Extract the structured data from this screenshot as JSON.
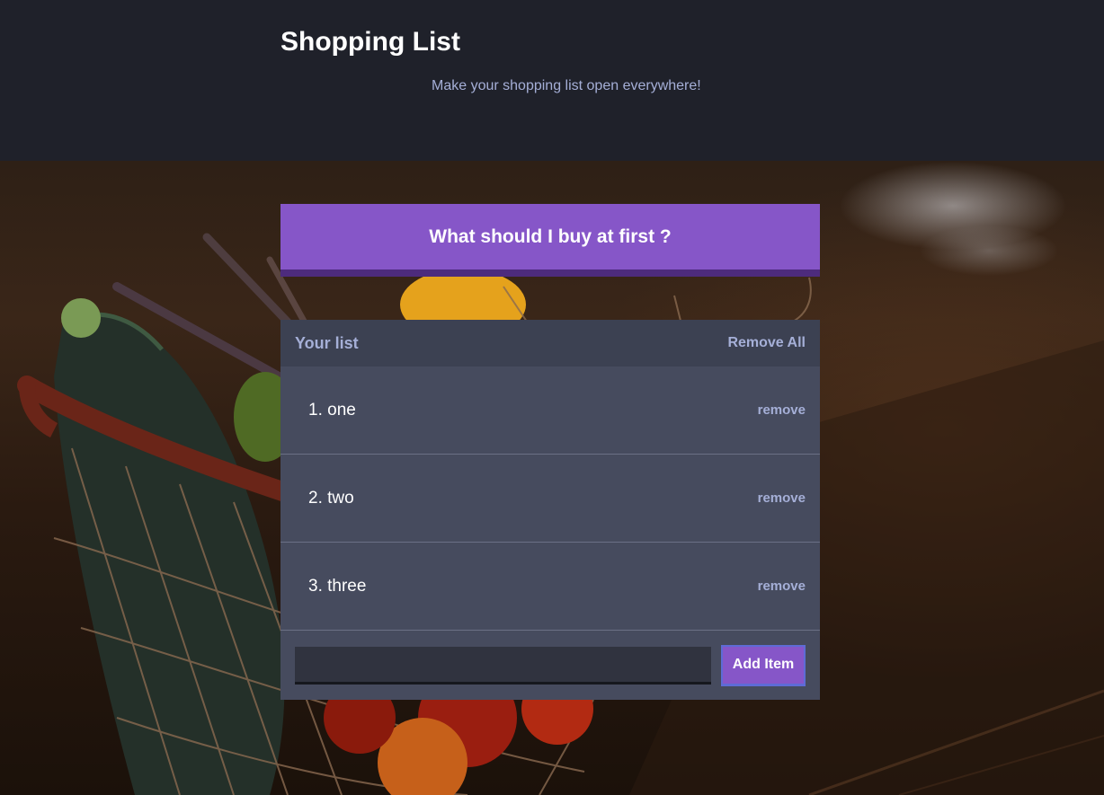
{
  "header": {
    "title": "Shopping List",
    "subtitle": "Make your shopping list open everywhere!"
  },
  "prompt": {
    "text": "What should I buy at first ?"
  },
  "list": {
    "title": "Your list",
    "remove_all_label": "Remove All",
    "items": [
      {
        "text": "1. one",
        "remove_label": "remove"
      },
      {
        "text": "2. two",
        "remove_label": "remove"
      },
      {
        "text": "3. three",
        "remove_label": "remove"
      }
    ]
  },
  "add_form": {
    "input_value": "",
    "button_label": "Add Item"
  },
  "colors": {
    "accent": "#8656c8",
    "accent_dark": "#4d2b7d",
    "header_bg": "#1f212a",
    "panel_bg": "#464b5e",
    "panel_header_bg": "#3c4152",
    "muted_text": "#a5afd7"
  },
  "background": {
    "description_icon": "vegetable-basket-photo"
  }
}
